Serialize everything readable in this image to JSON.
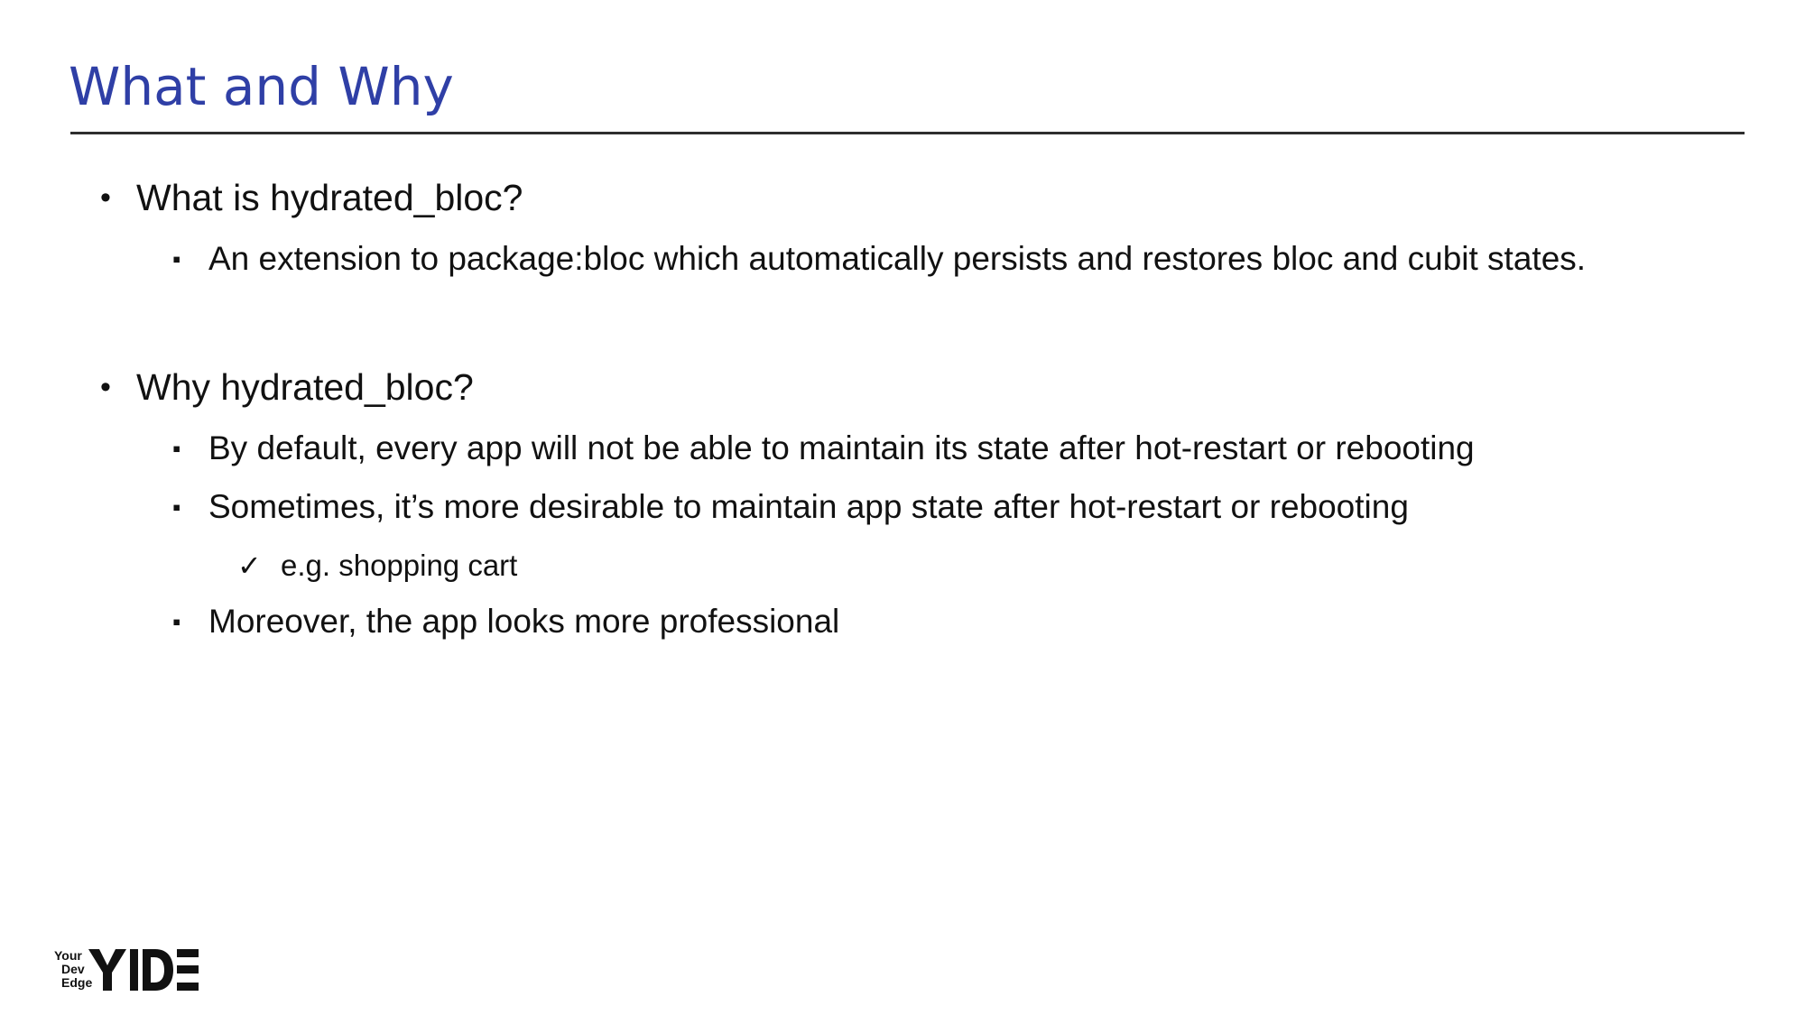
{
  "slide": {
    "title": "What and Why",
    "title_color": "#2f3fa6"
  },
  "content": [
    {
      "level": 1,
      "bullet": "•",
      "text": "What is hydrated_bloc?"
    },
    {
      "level": 2,
      "bullet": "▪",
      "text": "An extension to package:bloc which automatically persists and restores bloc and cubit states."
    },
    {
      "level": 1,
      "bullet": "•",
      "text": "Why hydrated_bloc?"
    },
    {
      "level": 2,
      "bullet": "▪",
      "text": "By default, every app will not be able to maintain its state after hot-restart or rebooting"
    },
    {
      "level": 2,
      "bullet": "▪",
      "text": "Sometimes, it’s more desirable to maintain app state after hot-restart or rebooting"
    },
    {
      "level": 3,
      "bullet": "✓",
      "text": "e.g. shopping cart"
    },
    {
      "level": 2,
      "bullet": "▪",
      "text": "Moreover, the app looks more professional"
    }
  ],
  "logo": {
    "line1": "Your",
    "line2": "Dev",
    "line3": "Edge",
    "mark": "YIDE"
  }
}
